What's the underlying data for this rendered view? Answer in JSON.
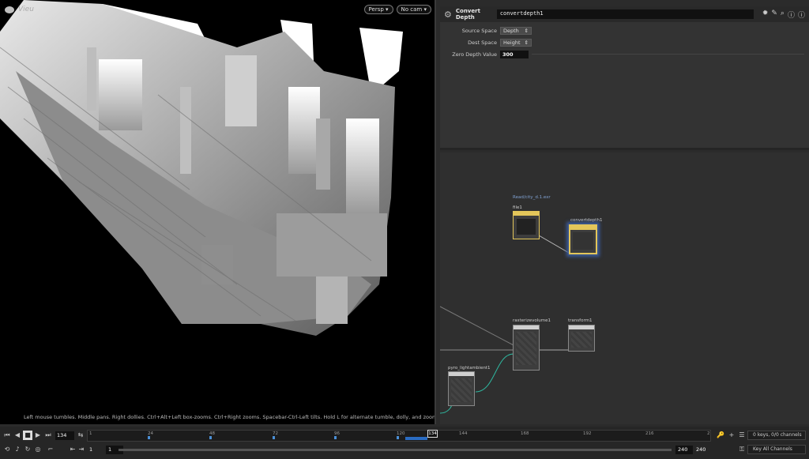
{
  "viewport": {
    "title": "Vieu",
    "perspective_label": "Persp",
    "camera_label": "No cam",
    "help_text": "Left mouse tumbles. Middle pans. Right dollies. Ctrl+Alt+Left box-zooms. Ctrl+Right zooms. Spacebar-Ctrl-Left tilts. Hold L for alternate tumble, dolly, and zoom.  M or Alt+M for First Person Navigation."
  },
  "params": {
    "node_type": "Convert Depth",
    "node_name": "convertdepth1",
    "rows": [
      {
        "label": "Source Space",
        "value": "Depth"
      },
      {
        "label": "Dest Space",
        "value": "Height"
      }
    ],
    "zero_depth_label": "Zero Depth Value",
    "zero_depth_value": "300"
  },
  "network": {
    "nodes": [
      {
        "name": "file1",
        "comment": "Read/city_d.1.exr"
      },
      {
        "name": "convertdepth1",
        "comment": ""
      },
      {
        "name": "rasterizevolume1",
        "comment": ""
      },
      {
        "name": "transform1",
        "comment": ""
      },
      {
        "name": "pyro_lightambient1",
        "comment": ""
      }
    ]
  },
  "timeline": {
    "current_frame": "134",
    "ticks": [
      "1",
      "24",
      "48",
      "72",
      "96",
      "120",
      "144",
      "168",
      "192",
      "216",
      "2"
    ],
    "start_frame": "1",
    "start_frame2": "1",
    "end_frame": "240",
    "end_frame2": "240",
    "channels_label": "0 keys, 0/0 channels",
    "key_all_label": "Key All Channels"
  }
}
